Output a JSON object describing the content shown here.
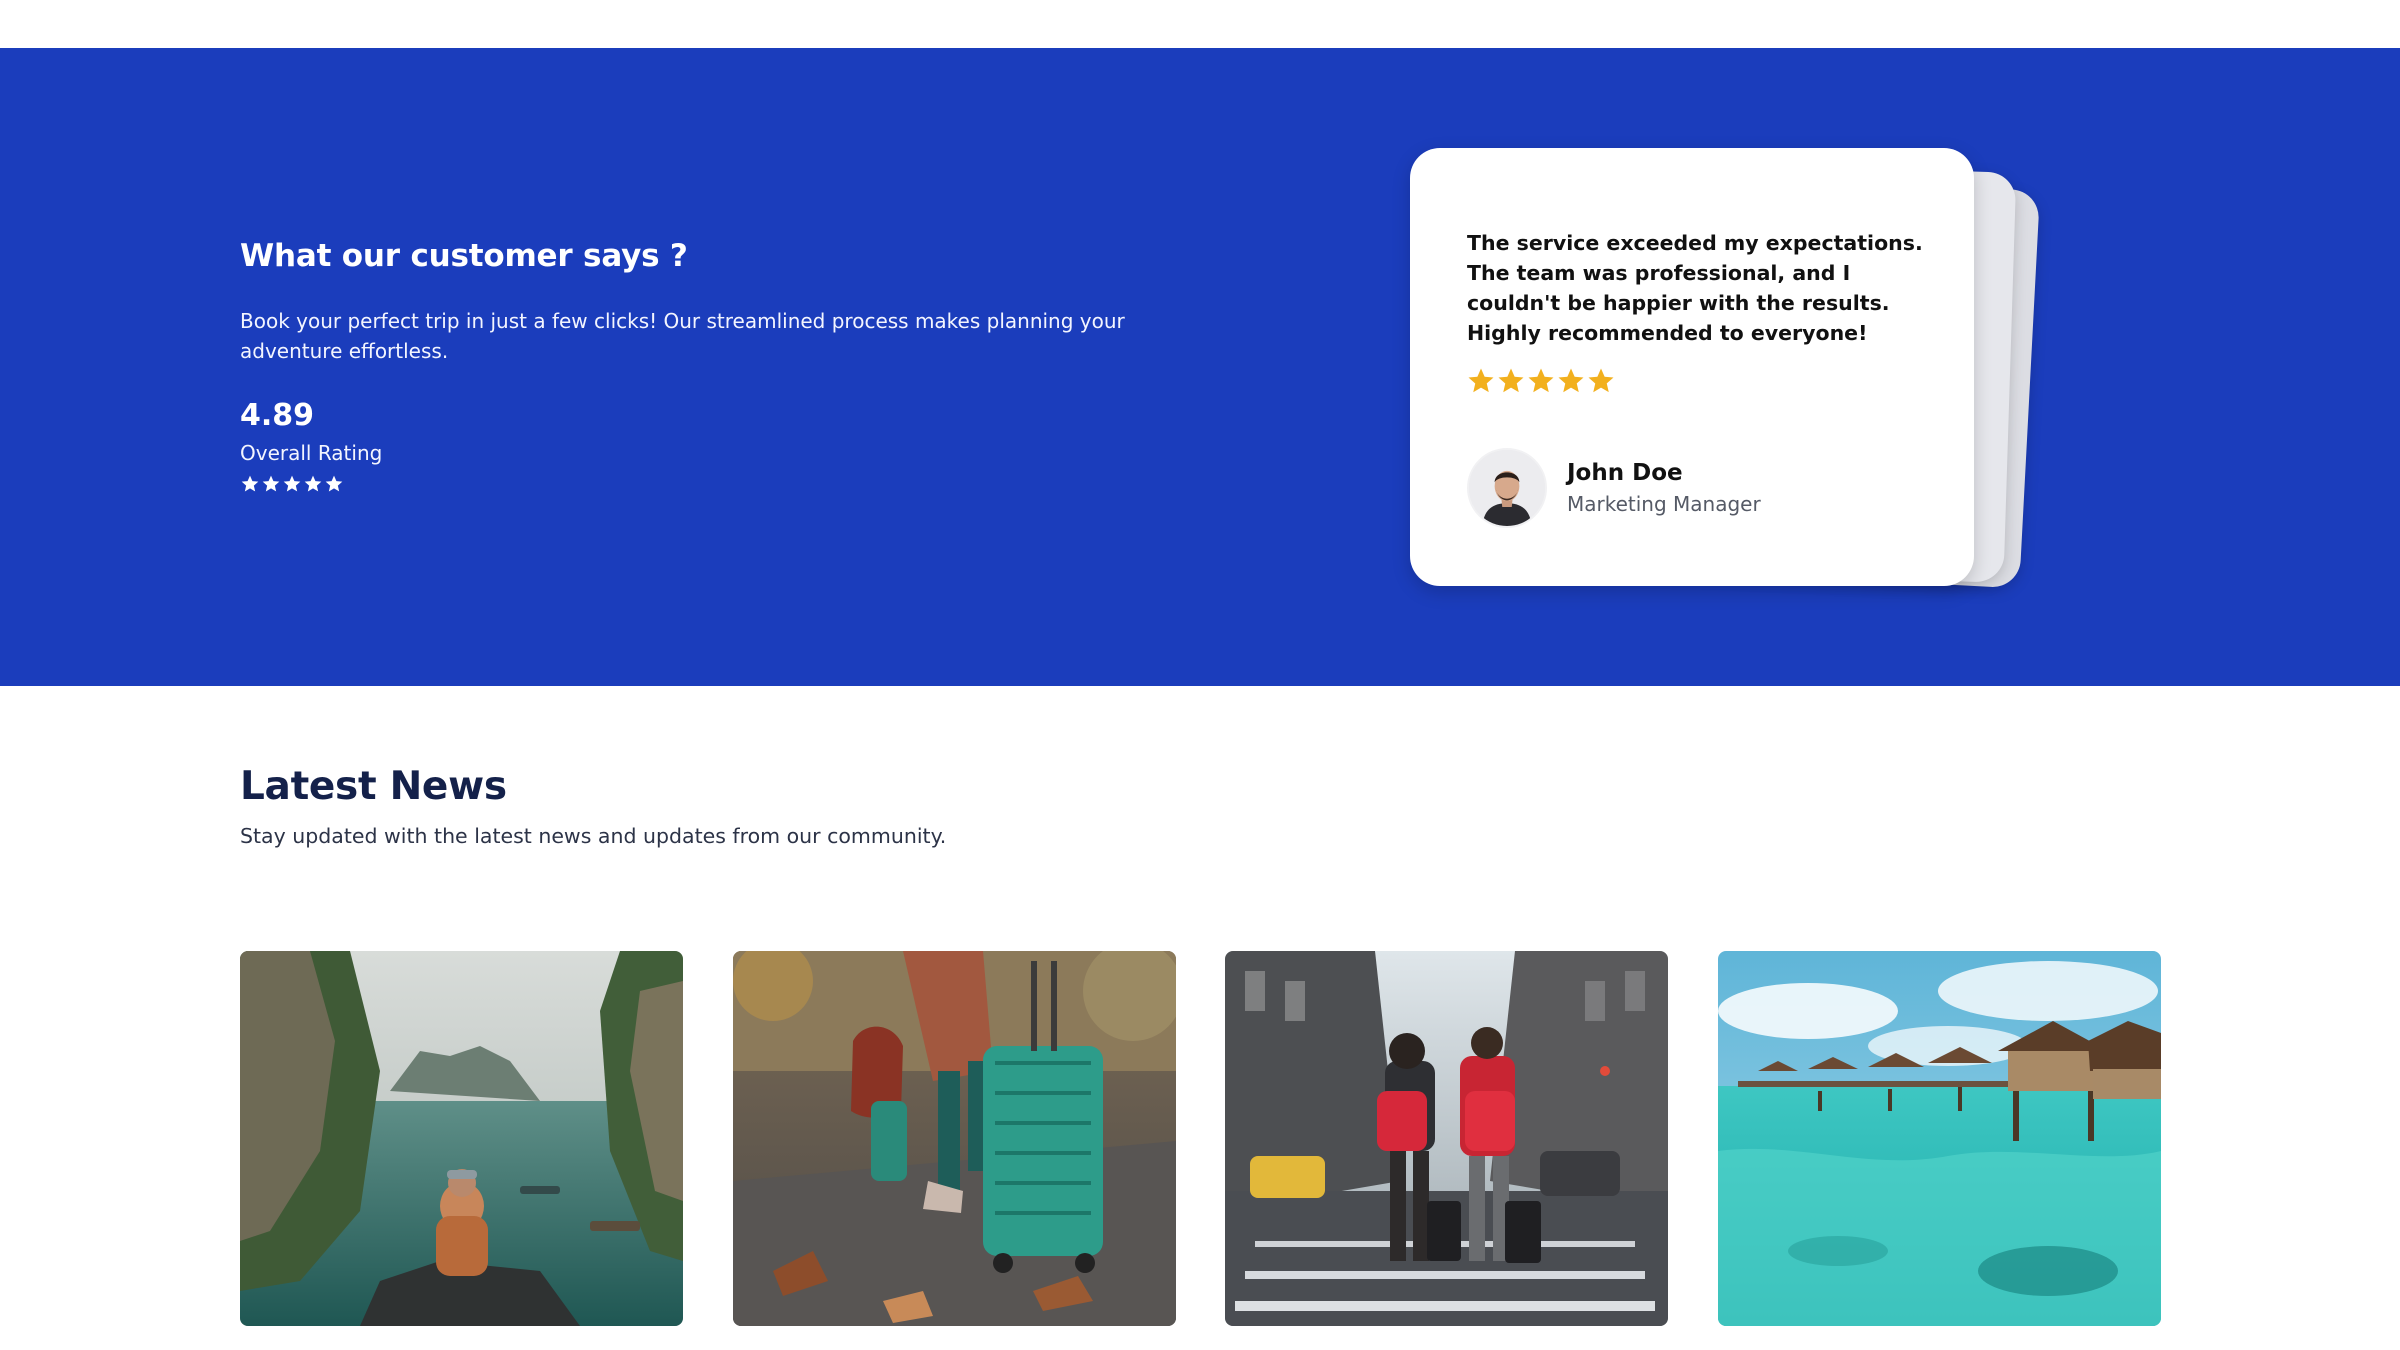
{
  "testimonials": {
    "heading": "What our customer says ?",
    "description": "Book your perfect trip in just a few clicks! Our streamlined process makes planning your adventure effortless.",
    "overall_rating_value": "4.89",
    "overall_rating_label": "Overall Rating",
    "overall_stars": 5,
    "card": {
      "quote": "The service exceeded my expectations. The team was professional, and I couldn't be happier with the results. Highly recommended to everyone!",
      "stars": 5,
      "author_name": "John Doe",
      "author_role": "Marketing Manager"
    }
  },
  "news": {
    "title": "Latest News",
    "subtitle": "Stay updated with the latest news and updates from our community.",
    "cards": [
      {
        "image": "traveler-overlooking-bay-photo"
      },
      {
        "image": "walking-with-suitcase-photo"
      },
      {
        "image": "travelers-city-street-photo"
      },
      {
        "image": "overwater-bungalows-photo"
      }
    ]
  },
  "colors": {
    "primary_blue": "#1b3dbc",
    "star_gold": "#f2b01e",
    "heading_navy": "#14214a"
  }
}
